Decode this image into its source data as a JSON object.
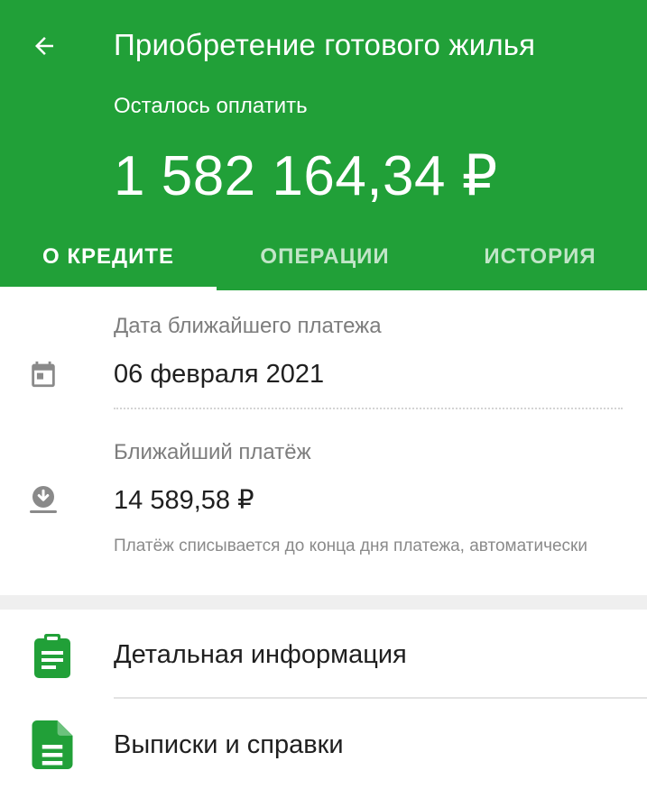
{
  "header": {
    "title": "Приобретение готового жилья",
    "remaining_label": "Осталось оплатить",
    "remaining_amount": "1 582 164,34 ₽",
    "background_color": "#21a038",
    "back_icon": "arrow-left-icon"
  },
  "tabs": [
    {
      "label": "О КРЕДИТЕ",
      "active": true
    },
    {
      "label": "ОПЕРАЦИИ",
      "active": false
    },
    {
      "label": "ИСТОРИЯ",
      "active": false
    }
  ],
  "payment_info": {
    "next_payment_date": {
      "label": "Дата ближайшего платежа",
      "value": "06 февраля 2021",
      "icon": "calendar-icon"
    },
    "next_payment": {
      "label": "Ближайший платёж",
      "value": "14 589,58 ₽",
      "icon": "download-icon",
      "note": "Платёж списывается до конца дня платежа, автоматически"
    }
  },
  "menu": [
    {
      "label": "Детальная информация",
      "icon": "clipboard-icon"
    },
    {
      "label": "Выписки и справки",
      "icon": "document-icon"
    }
  ],
  "colors": {
    "accent": "#21a038",
    "icon_gray": "#8a8a8a",
    "text_primary": "#1f1f1f",
    "text_secondary": "#7d7d7d"
  }
}
